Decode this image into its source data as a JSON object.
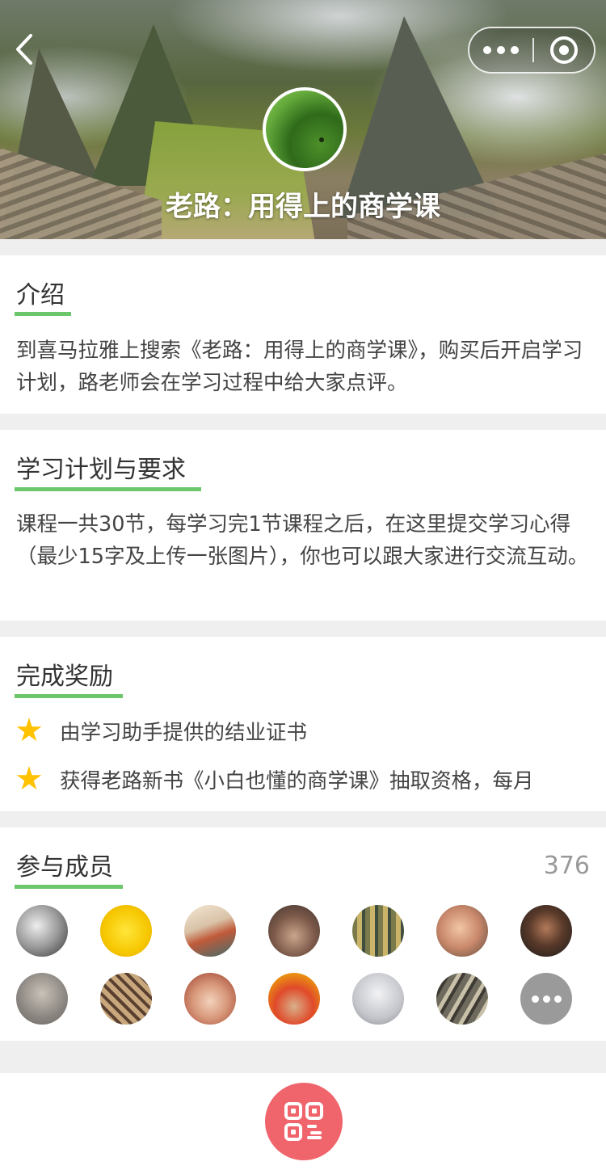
{
  "header": {
    "title": "老路：用得上的商学课",
    "back_icon": "back-arrow-icon",
    "menu_icon": "more-dots-icon",
    "close_icon": "target-circle-icon"
  },
  "sections": {
    "intro": {
      "title": "介绍",
      "text": "到喜马拉雅上搜索《老路：用得上的商学课》，购买后开启学习计划，路老师会在学习过程中给大家点评。"
    },
    "plan": {
      "title": "学习计划与要求",
      "text": "课程一共30节，每学习完1节课程之后，在这里提交学习心得（最少15字及上传一张图片），你也可以跟大家进行交流互动。"
    },
    "reward": {
      "title": "完成奖励",
      "items": [
        "由学习助手提供的结业证书",
        "获得老路新书《小白也懂的商学课》抽取资格，每月"
      ]
    },
    "members": {
      "title": "参与成员",
      "count": "376"
    }
  },
  "colors": {
    "accent_green": "#6cc66b",
    "star_yellow": "#ffc200",
    "qr_button": "#f0646c"
  },
  "bottom": {
    "qr_icon": "qr-code-icon"
  }
}
